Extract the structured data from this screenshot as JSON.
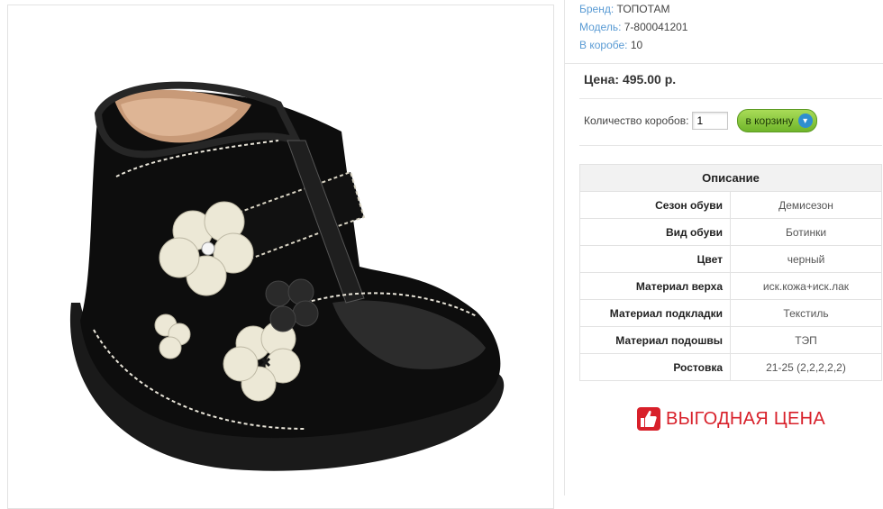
{
  "product": {
    "brand_label": "Бренд:",
    "brand_value": "ТОПОТАМ",
    "model_label": "Модель:",
    "model_value": "7-800041201",
    "box_label": "В коробе:",
    "box_value": "10",
    "price_text": "Цена: 495.00 р.",
    "quantity_label": "Количество коробов:",
    "quantity_value": "1",
    "cart_button_label": "в корзину",
    "image_icon": "black-boots-photo"
  },
  "description": {
    "title": "Описание",
    "rows": [
      {
        "key": "Сезон обуви",
        "value": "Демисезон"
      },
      {
        "key": "Вид обуви",
        "value": "Ботинки"
      },
      {
        "key": "Цвет",
        "value": "черный"
      },
      {
        "key": "Материал верха",
        "value": "иск.кожа+иск.лак"
      },
      {
        "key": "Материал подкладки",
        "value": "Текстиль"
      },
      {
        "key": "Материал подошвы",
        "value": "ТЭП"
      },
      {
        "key": "Ростовка",
        "value": "21-25 (2,2,2,2,2)"
      }
    ]
  },
  "promo": {
    "text": "ВЫГОДНАЯ ЦЕНА",
    "icon": "thumbs-up-icon",
    "color": "#d8202a"
  },
  "colors": {
    "link_label": "#5a9bd4",
    "button_green": "#6fb52a"
  }
}
